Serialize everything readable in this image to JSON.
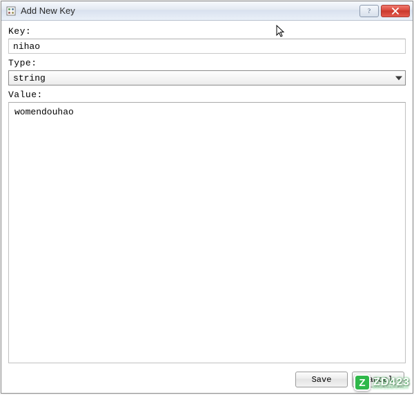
{
  "window": {
    "title": "Add New Key"
  },
  "form": {
    "key_label": "Key:",
    "key_value": "nihao",
    "type_label": "Type:",
    "type_value": "string",
    "value_label": "Value:",
    "value_text": "womendouhao"
  },
  "buttons": {
    "save": "Save",
    "cancel": "Cancel"
  },
  "watermark": {
    "badge": "Z",
    "text": "ZD423",
    "sub": "www.zdfans.com"
  }
}
